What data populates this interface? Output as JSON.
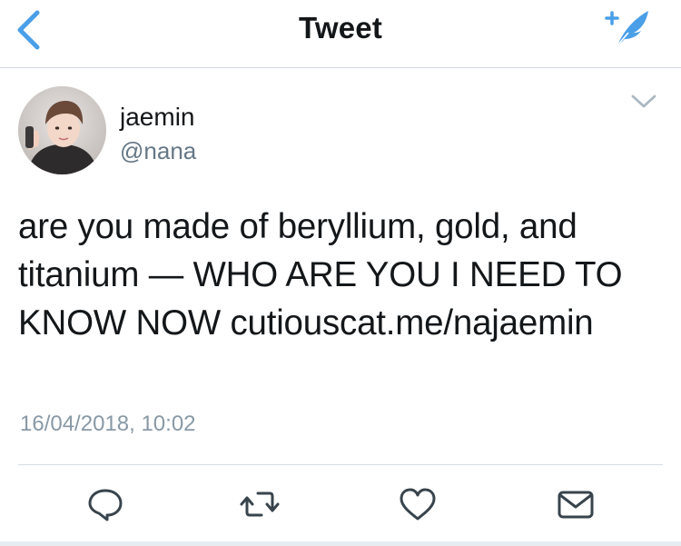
{
  "navbar": {
    "title": "Tweet"
  },
  "tweet": {
    "display_name": "jaemin",
    "handle": "@nana",
    "text_lines": [
      "are you made of beryllium, gold, and",
      "titanium — WHO ARE YOU I NEED TO",
      "KNOW NOW cutiouscat.me/najaemin"
    ],
    "timestamp": "16/04/2018, 10:02"
  },
  "icons": {
    "back": "chevron-left-icon",
    "compose": "compose-feather-icon",
    "caret": "chevron-down-icon",
    "reply": "reply-bubble-icon",
    "retweet": "retweet-icon",
    "like": "heart-icon",
    "dm": "envelope-icon"
  },
  "colors": {
    "accent": "#4a9fe8",
    "text": "#14171a",
    "secondary_text": "#657786",
    "timestamp_text": "#8899a6",
    "action_icon": "#38444d",
    "divider": "#d8dee3"
  }
}
